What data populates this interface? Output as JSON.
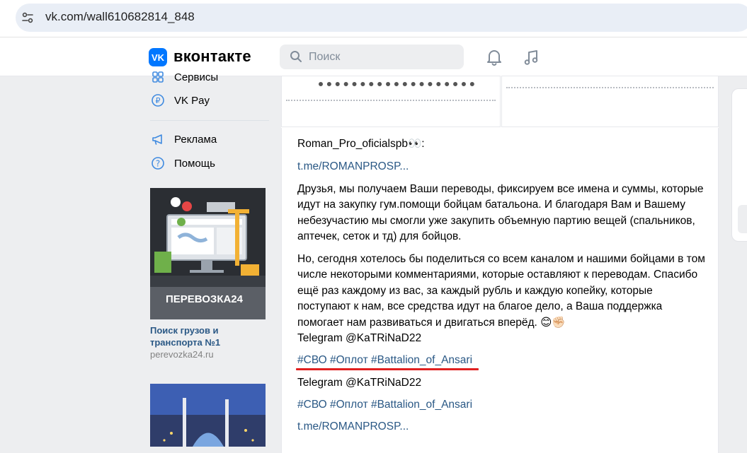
{
  "browser": {
    "url": "vk.com/wall610682814_848",
    "site_info_icon": "tune-icon"
  },
  "header": {
    "brand": "вконтакте",
    "logo_text": "VK",
    "search_placeholder": "Поиск",
    "icons": [
      "bell-icon",
      "music-note-icon"
    ]
  },
  "nav": {
    "items": [
      {
        "label": "Сервисы",
        "icon": "grid-icon"
      },
      {
        "label": "VK Pay",
        "icon": "ruble-coin-icon"
      },
      {
        "label": "Реклама",
        "icon": "megaphone-icon"
      },
      {
        "label": "Помощь",
        "icon": "help-icon"
      }
    ]
  },
  "ad": {
    "image_caption": "ПЕРЕВОЗКА24",
    "title": "Поиск грузов и транспорта №1",
    "domain": "perevozka24.ru"
  },
  "post": {
    "author_line": "Roman_Pro_oficialspb👀:",
    "link1": "t.me/ROMANPROSP...",
    "para1": "Друзья, мы получаем Ваши переводы, фиксируем все имена и суммы, которые идут на закупку гум.помощи бойцам батальона. И благодаря Вам и Вашему небезучастию мы смогли уже закупить объемную партию вещей (спальников, аптечек, сеток и тд) для бойцов.",
    "para2": "Но, сегодня хотелось бы поделиться со всем каналом и нашими бойцами в том числе  некоторыми комментариями, которые оставляют к переводам. Спасибо ещё раз каждому из вас, за каждый рубль и каждую копейку, которые поступают к нам, все средства идут на благое дело, а Ваша поддержка помогает нам развиваться и двигаться вперёд. 😊✊🏻",
    "telegram1": "Telegram @KaTRiNaD22",
    "hashtags1": "#СВО #Оплот #Battalion_of_Ansari",
    "telegram2": "Telegram @KaTRiNaD22",
    "hashtags2": "#СВО #Оплот #Battalion_of_Ansari",
    "link2": "t.me/ROMANPROSP..."
  },
  "colors": {
    "accent": "#0077ff",
    "link": "#2a5885",
    "highlight": "#e02020",
    "page_bg": "#edeef0"
  }
}
